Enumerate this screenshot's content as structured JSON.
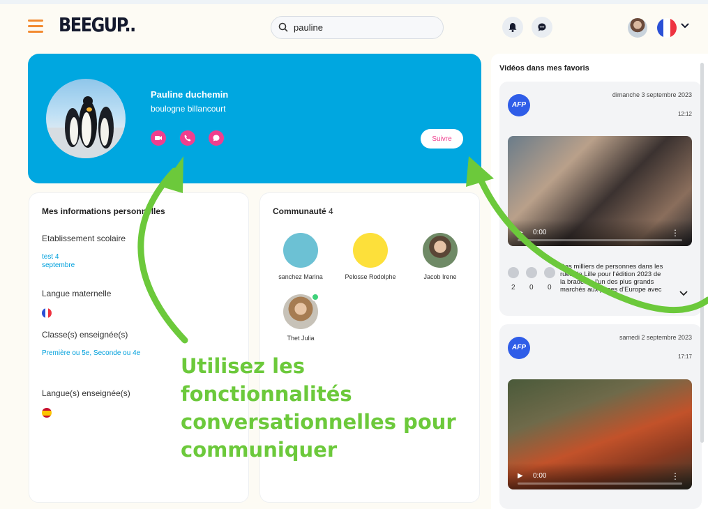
{
  "header": {
    "logo": "BEEGUP..",
    "search_value": "pauline",
    "language_flag": "fr"
  },
  "profile": {
    "name": "Pauline duchemin",
    "city": "boulogne billancourt",
    "follow_label": "Suivre"
  },
  "personal_info": {
    "title": "Mes informations personnelles",
    "school_label": "Etablissement scolaire",
    "school_value_line1": "test 4",
    "school_value_line2": "septembre",
    "native_language_label": "Langue maternelle",
    "classes_label": "Classe(s) enseignée(s)",
    "classes_value": "Première ou 5e, Seconde ou 4e",
    "taught_languages_label": "Langue(s) enseignée(s)"
  },
  "community": {
    "title": "Communauté",
    "count": "4",
    "members": [
      {
        "name": "sanchez Marina",
        "color": "#6cc1d4"
      },
      {
        "name": "Pelosse Rodolphe",
        "color": "#fde03a"
      },
      {
        "name": "Jacob Irene",
        "color": "#7a6a5a"
      },
      {
        "name": "Thet Julia",
        "color": "#b08a6a"
      }
    ]
  },
  "favorites": {
    "title": "Vidéos dans mes favoris",
    "videos": [
      {
        "source": "AFP",
        "date": "dimanche 3 septembre 2023",
        "time": "12:12",
        "player_time": "0:00",
        "likes": "2",
        "shares": "0",
        "comments": "0",
        "desc1": "Des milliers de personnes dans les",
        "desc2": "rues de Lille pour l'édition 2023 de",
        "desc3": "la braderie, l'un des plus grands",
        "desc4": "marchés aux puces d'Europe avec"
      },
      {
        "source": "AFP",
        "date": "samedi 2 septembre 2023",
        "time": "17:17",
        "player_time": "0:00"
      }
    ]
  },
  "overlay": {
    "line1": "Utilisez les",
    "line2": "fonctionnalités",
    "line3": "conversationnelles pour",
    "line4": "communiquer"
  },
  "colors": {
    "accent_blue": "#00a7e0",
    "pink": "#ef3f8e",
    "green": "#6cc93b",
    "orange": "#f28a30"
  }
}
